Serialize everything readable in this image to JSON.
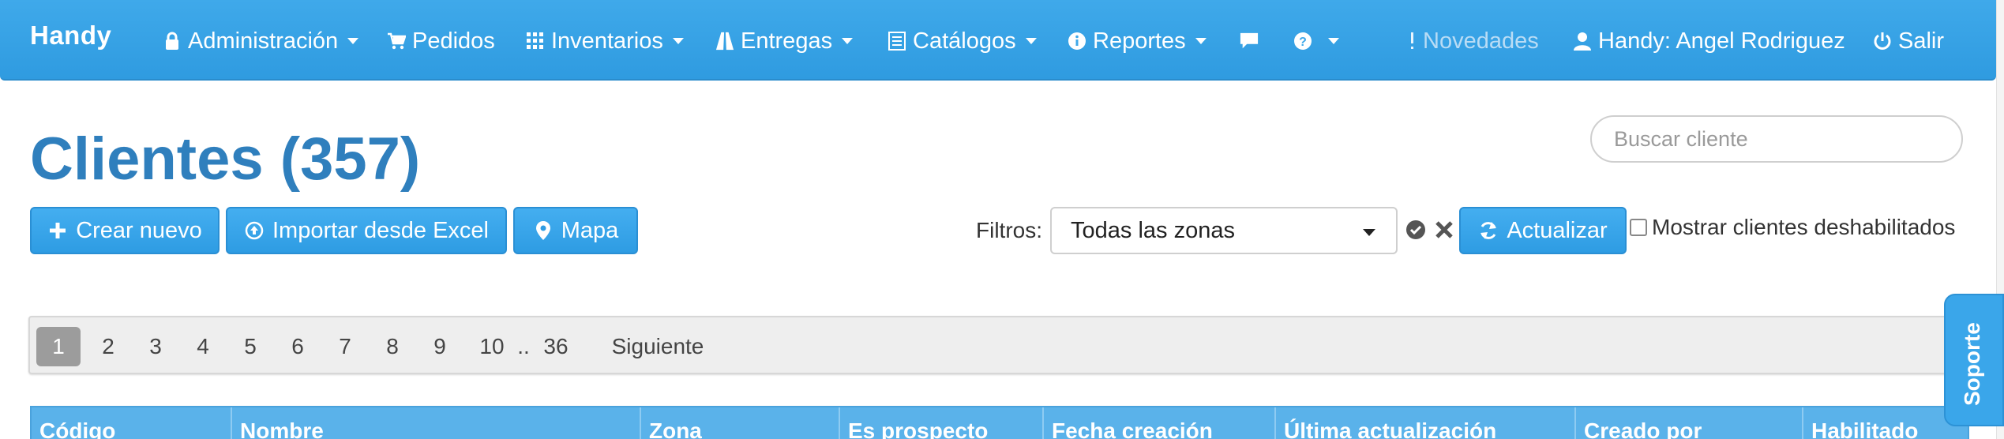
{
  "nav": {
    "brand": "Handy",
    "items": [
      {
        "label": "Administración",
        "icon": "lock-icon",
        "dropdown": true
      },
      {
        "label": "Pedidos",
        "icon": "cart-icon",
        "dropdown": false
      },
      {
        "label": "Inventarios",
        "icon": "grid-icon",
        "dropdown": true
      },
      {
        "label": "Entregas",
        "icon": "road-icon",
        "dropdown": true
      },
      {
        "label": "Catálogos",
        "icon": "list-icon",
        "dropdown": true
      },
      {
        "label": "Reportes",
        "icon": "info-icon",
        "dropdown": true
      },
      {
        "label": "",
        "icon": "chat-icon",
        "dropdown": false
      },
      {
        "label": "",
        "icon": "help-icon",
        "dropdown": true
      }
    ],
    "news": "Novedades",
    "user": "Handy: Angel Rodriguez",
    "logout": "Salir"
  },
  "page": {
    "title": "Clientes (357)",
    "search_placeholder": "Buscar cliente"
  },
  "actions": {
    "create": "Crear nuevo",
    "import": "Importar desde Excel",
    "map": "Mapa",
    "refresh": "Actualizar"
  },
  "filters": {
    "label": "Filtros:",
    "zone_selected": "Todas las zonas",
    "show_disabled_label": "Mostrar clientes deshabilitados",
    "show_disabled_checked": false
  },
  "pagination": {
    "pages": [
      "1",
      "2",
      "3",
      "4",
      "5",
      "6",
      "7",
      "8",
      "9",
      "10",
      "..",
      "36"
    ],
    "active": "1",
    "next": "Siguiente"
  },
  "support_tab": "Soporte",
  "table": {
    "columns": [
      "Código",
      "Nombre",
      "Zona",
      "Es prospecto",
      "Fecha creación",
      "Última actualización",
      "Creado por",
      "Habilitado"
    ]
  },
  "colors": {
    "navbar": "#3fa9ea",
    "title": "#2f7fbd",
    "button": "#2e9ce3",
    "table_header": "#5ab2ea"
  }
}
